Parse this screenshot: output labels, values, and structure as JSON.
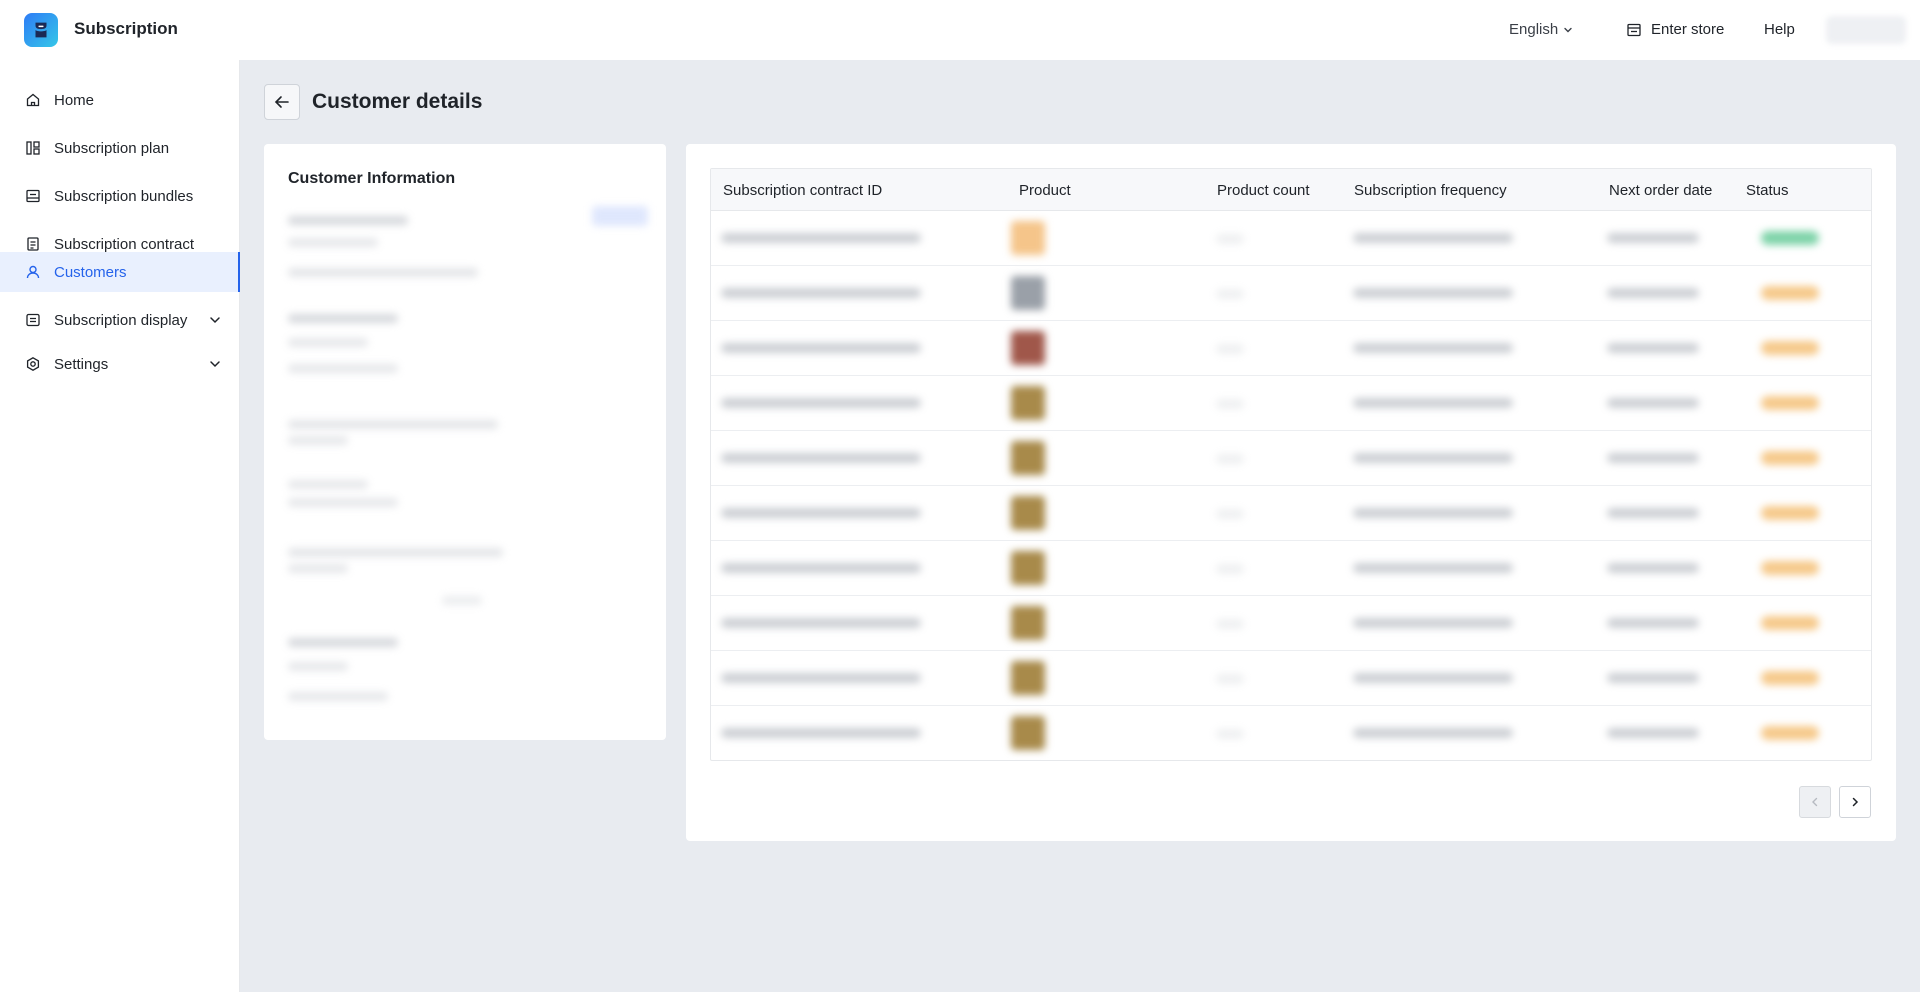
{
  "app": {
    "title": "Subscription",
    "logo_icon": "subscription-logo-icon",
    "brand_color": "#2e7cf6"
  },
  "topbar": {
    "language": "English",
    "enter_store": "Enter store",
    "help": "Help"
  },
  "sidebar": {
    "items": [
      {
        "label": "Home",
        "icon": "home-icon"
      },
      {
        "label": "Subscription plan",
        "icon": "plan-icon"
      },
      {
        "label": "Subscription bundles",
        "icon": "bundle-icon"
      },
      {
        "label": "Subscription contract",
        "icon": "contract-icon"
      },
      {
        "label": "Customers",
        "icon": "user-icon",
        "active": true
      },
      {
        "label": "Subscription display",
        "icon": "display-icon",
        "expandable": true
      },
      {
        "label": "Settings",
        "icon": "settings-icon",
        "expandable": true
      }
    ],
    "active_color": "#2563eb"
  },
  "page": {
    "title": "Customer details"
  },
  "customer_info": {
    "title": "Customer Information"
  },
  "table": {
    "columns": [
      "Subscription contract ID",
      "Product",
      "Product count",
      "Subscription frequency",
      "Next order date",
      "Status"
    ],
    "row_count": 10,
    "status_colors": [
      "#7dd3a8",
      "#f6c98a",
      "#f6c98a",
      "#f6c98a",
      "#f6c98a",
      "#f6c98a",
      "#f6c98a",
      "#f6c98a",
      "#f6c98a",
      "#f6c98a"
    ],
    "thumb_colors": [
      "#f5c58a",
      "#9aa0a8",
      "#a0574a",
      "#a88a4a",
      "#a88a4a",
      "#a88a4a",
      "#a88a4a",
      "#a88a4a",
      "#a88a4a",
      "#a88a4a"
    ]
  }
}
